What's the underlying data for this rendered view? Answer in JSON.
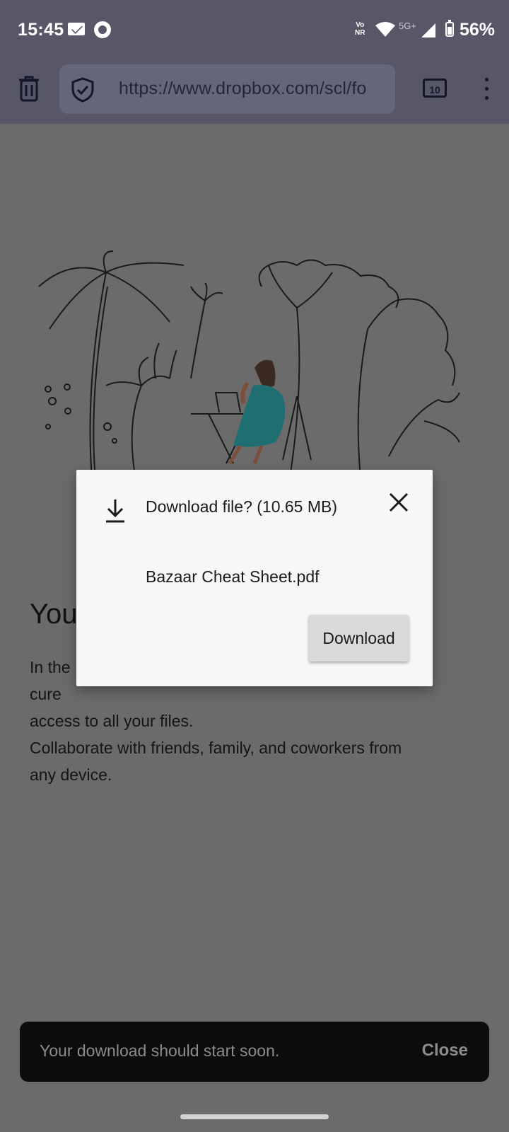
{
  "status_bar": {
    "time": "15:45",
    "network_label_top": "Vo",
    "network_label_bottom": "NR",
    "network_type": "5G+",
    "battery_percent": "56%",
    "icons": [
      "mail-icon",
      "sync-icon",
      "vonr-icon",
      "wifi-icon",
      "signal-icon",
      "battery-icon"
    ]
  },
  "toolbar": {
    "url": "https://www.dropbox.com/scl/fo",
    "tab_count": "10",
    "icons": [
      "trash-icon",
      "shield-icon",
      "tabs-icon",
      "menu-dots-icon"
    ]
  },
  "page": {
    "heading": "You",
    "paragraph_line1": "In the",
    "paragraph_line1_end": "cure",
    "paragraph_line2": "access to all your files.",
    "paragraph_line3": "Collaborate with friends, family, and coworkers from",
    "paragraph_line4": "any device."
  },
  "dialog": {
    "title": "Download file? (10.65 MB)",
    "file_name": "Bazaar Cheat Sheet.pdf",
    "download_button": "Download",
    "icons": [
      "download-icon",
      "close-icon"
    ]
  },
  "snackbar": {
    "message": "Your download should start soon.",
    "action": "Close"
  },
  "colors": {
    "status_toolbar_bg": "#575768",
    "scrim_page_bg": "#6b6b6b",
    "dialog_bg": "#f7f7f7",
    "snackbar_bg": "#0c0c0c"
  }
}
